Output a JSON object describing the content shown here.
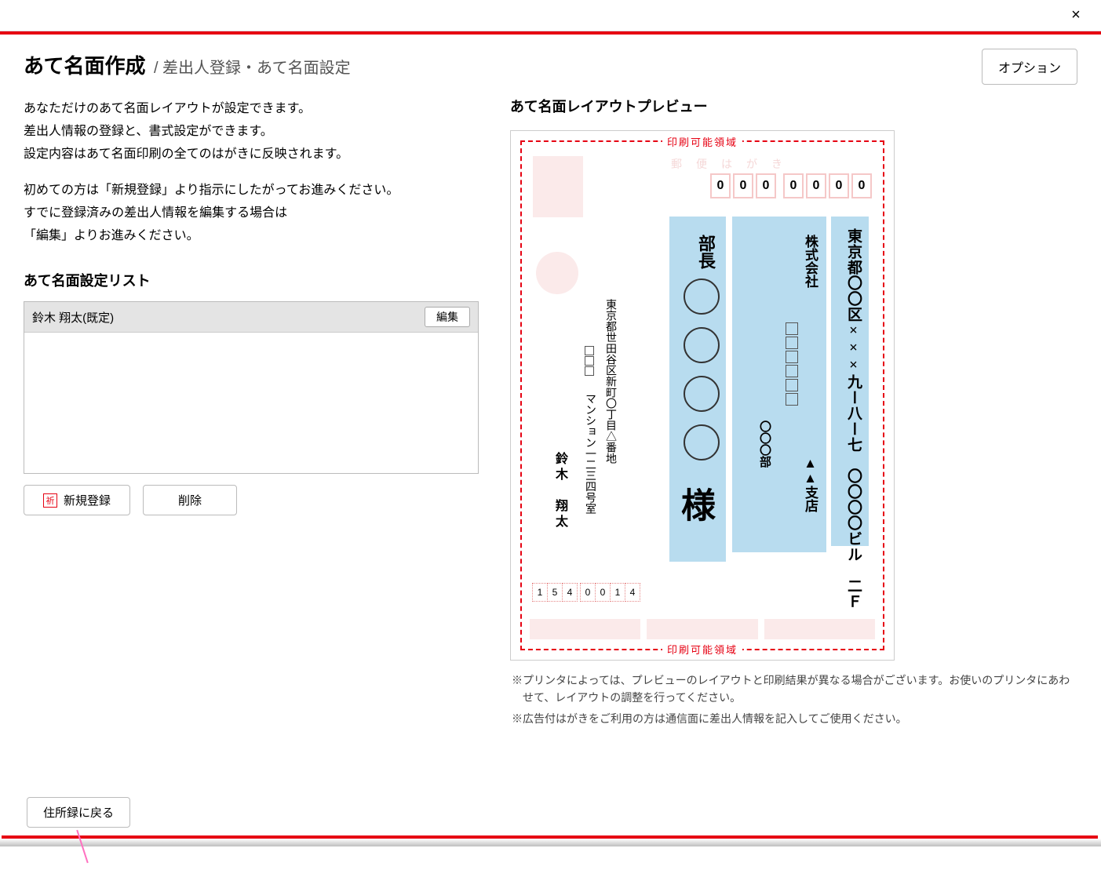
{
  "titlebar": {
    "close": "×"
  },
  "header": {
    "title": "あて名面作成",
    "subtitle": "/ 差出人登録・あて名面設定",
    "options": "オプション"
  },
  "intro": {
    "l1": "あなただけのあて名面レイアウトが設定できます。",
    "l2": "差出人情報の登録と、書式設定ができます。",
    "l3": "設定内容はあて名面印刷の全てのはがきに反映されます。",
    "l4": "初めての方は「新規登録」より指示にしたがってお進みください。",
    "l5": "すでに登録済みの差出人情報を編集する場合は",
    "l6": "「編集」よりお進みください。"
  },
  "list": {
    "heading": "あて名面設定リスト",
    "items": [
      {
        "name": "鈴木 翔太(既定)",
        "edit": "編集"
      }
    ]
  },
  "buttons": {
    "new": "新規登録",
    "delete": "削除",
    "back": "住所録に戻る"
  },
  "preview": {
    "heading": "あて名面レイアウトプレビュー",
    "print_area": "印刷可能領域",
    "faint": "郵便はがき",
    "recv_zip": [
      "0",
      "0",
      "0",
      "0",
      "0",
      "0",
      "0"
    ],
    "recv_addr1": "東京都〇〇区×××九ー八ー七　〇〇〇〇ビル　二Ｆ",
    "recv_company": "株式会社",
    "recv_dept_suffix": "部",
    "recv_branch": "▲▲支店",
    "recv_dept2": "〇〇〇部",
    "recv_title": "部長",
    "recv_sama": "様",
    "send_addr1": "東京都世田谷区新町〇丁目△番地",
    "send_addr2": "マンション一二三四号室",
    "send_name": "鈴木　翔太",
    "send_zip": [
      "1",
      "5",
      "4",
      "0",
      "0",
      "1",
      "4"
    ]
  },
  "disclaimer": {
    "d1": "※プリンタによっては、プレビューのレイアウトと印刷結果が異なる場合がございます。お使いのプリンタにあわせて、レイアウトの調整を行ってください。",
    "d2": "※広告付はがきをご利用の方は通信面に差出人情報を記入してご使用ください。"
  }
}
